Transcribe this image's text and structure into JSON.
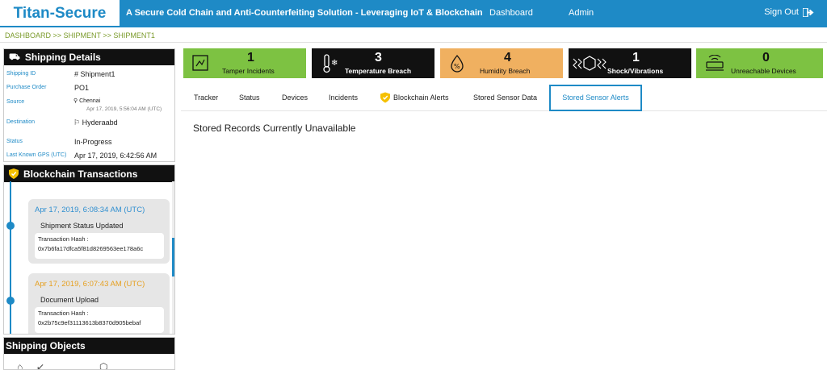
{
  "header": {
    "brand": "Titan-Secure",
    "tagline": "A Secure Cold Chain and Anti-Counterfeiting Solution - Leveraging IoT & Blockchain",
    "nav": [
      "Dashboard",
      "Admin"
    ],
    "signout": "Sign Out",
    "bg_color": "#1e8ac6"
  },
  "breadcrumb": "DASHBOARD >> SHIPMENT >> SHIPMENT1",
  "shipping_details": {
    "title": "Shipping Details",
    "rows": [
      {
        "label": "Shipping ID",
        "value": "# Shipment1"
      },
      {
        "label": "Purchase Order",
        "value": "PO1"
      },
      {
        "label": "Source",
        "value": "Chennai",
        "sub": "Apr 17, 2019, 5:56:04 AM (UTC)"
      },
      {
        "label": "Destination",
        "value": "Hyderaabd"
      },
      {
        "label": "Status",
        "value": "In-Progress"
      },
      {
        "label": "Last Known GPS (UTC)",
        "value": "Apr 17, 2019, 6:42:56 AM"
      }
    ]
  },
  "blockchain": {
    "title": "Blockchain Transactions",
    "hash_label": "Transaction Hash :",
    "transactions": [
      {
        "time": "Apr 17, 2019, 6:08:34 AM (UTC)",
        "title": "Shipment Status Updated",
        "hash": "0x7b6fa17dfca5f81d8269563ee178a6c",
        "color": "#2f8fd0"
      },
      {
        "time": "Apr 17, 2019, 6:07:43 AM (UTC)",
        "title": "Document Upload",
        "hash": "0x2b75c9ef31113613b8370d905bebaf",
        "color": "#e6a020"
      }
    ]
  },
  "shipping_objects": {
    "title": "Shipping Objects"
  },
  "stats": [
    {
      "count": "1",
      "label": "Tamper Incidents",
      "icon": "tamper-icon",
      "bg": "#7dc242",
      "fg": "#111"
    },
    {
      "count": "3",
      "label": "Temperature Breach",
      "icon": "thermometer-icon",
      "bg": "#111111",
      "fg": "#fff"
    },
    {
      "count": "4",
      "label": "Humidity Breach",
      "icon": "humidity-icon",
      "bg": "#f0b060",
      "fg": "#111"
    },
    {
      "count": "1",
      "label": "Shock/Vibrations",
      "icon": "shock-icon",
      "bg": "#111111",
      "fg": "#fff"
    },
    {
      "count": "0",
      "label": "Unreachable Devices",
      "icon": "router-icon",
      "bg": "#7dc242",
      "fg": "#111"
    }
  ],
  "tabs": [
    "Tracker",
    "Status",
    "Devices",
    "Incidents",
    "Blockchain Alerts",
    "Stored Sensor Data",
    "Stored Sensor Alerts"
  ],
  "active_tab": "Stored Sensor Alerts",
  "content_message": "Stored Records Currently Unavailable"
}
